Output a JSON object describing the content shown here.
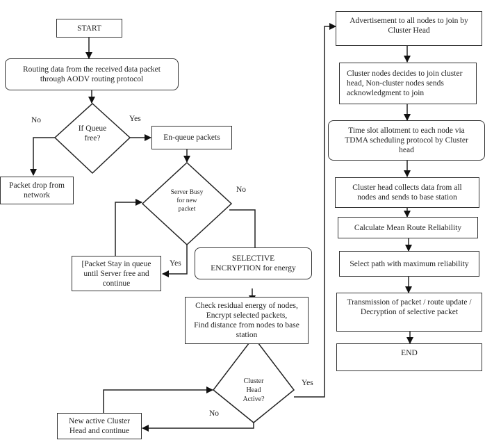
{
  "diagram": {
    "nodes": {
      "start": "START",
      "routing": "Routing data from the received data packet\nthrough AODV routing protocol",
      "queue_decision": "If Queue\nfree?",
      "enqueue": "En-queue packets",
      "packet_drop": "Packet drop from\nnetwork",
      "server_decision": "Server Busy\nfor new\npacket",
      "packet_stay": "[Packet Stay in queue\nuntil Server free and\ncontinue",
      "selective_encryption": "SELECTIVE\nENCRYPTION for energy",
      "check_energy": "Check residual energy of nodes,\nEncrypt selected packets,\nFind distance from nodes to base\nstation",
      "cluster_decision": "Cluster\nHead\nActive?",
      "new_cluster_head": "New active Cluster\nHead and continue",
      "advertisement": "Advertisement to all nodes to join by\nCluster Head",
      "cluster_join": "Cluster nodes decides to join cluster\nhead, Non-cluster nodes sends\nacknowledgment to join",
      "time_slot": "Time slot allotment to each node via\nTDMA scheduling protocol by Cluster\nhead",
      "collect_data": "Cluster head collects data from all\nnodes and sends to base station",
      "mean_reliability": "Calculate Mean Route Reliability",
      "select_path": "Select path with maximum reliability",
      "transmission": "Transmission of packet / route update /\nDecryption of selective packet",
      "end": "END"
    },
    "edge_labels": {
      "queue_no": "No",
      "queue_yes": "Yes",
      "server_no": "No",
      "server_yes": "Yes",
      "cluster_yes": "Yes",
      "cluster_no": "No"
    }
  }
}
